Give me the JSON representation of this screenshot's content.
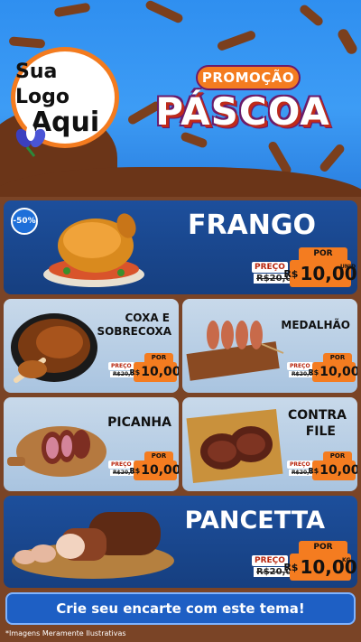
{
  "header": {
    "logo_line1": "Sua Logo",
    "logo_line2": "Aqui",
    "promo_top": "PROMOÇÃO",
    "promo_main": "PÁSCOA"
  },
  "colors": {
    "accent": "#f47c20",
    "card_dark": "#1d4f9c",
    "card_light": "#b7cde4",
    "chocolate": "#6b3518",
    "sky": "#3d9cf5"
  },
  "products": [
    {
      "name": "FRANGO",
      "badge": "-50%",
      "preco_label": "PREÇO",
      "old_price": "R$20,00",
      "por_label": "POR",
      "currency": "R$",
      "price": "10,00",
      "unit": "UNID"
    },
    {
      "name_line1": "COXA E",
      "name_line2": "SOBRECOXA",
      "preco_label": "PREÇO",
      "old_price": "R$20,00",
      "por_label": "POR",
      "currency": "R$",
      "price": "10,00"
    },
    {
      "name": "MEDALHÃO",
      "preco_label": "PREÇO",
      "old_price": "R$20,00",
      "por_label": "POR",
      "currency": "R$",
      "price": "10,00"
    },
    {
      "name": "PICANHA",
      "preco_label": "PREÇO",
      "old_price": "R$20,00",
      "por_label": "POR",
      "currency": "R$",
      "price": "10,00"
    },
    {
      "name_line1": "CONTRA",
      "name_line2": "FILE",
      "preco_label": "PREÇO",
      "old_price": "R$20,00",
      "por_label": "POR",
      "currency": "R$",
      "price": "10,00"
    },
    {
      "name": "PANCETTA",
      "preco_label": "PREÇO",
      "old_price": "R$20,00",
      "por_label": "POR",
      "currency": "R$",
      "price": "10,00",
      "unit": "KG"
    }
  ],
  "cta": "Crie seu encarte com este tema!",
  "footnote": "*Imagens Meramente Ilustrativas",
  "icons": [
    "flower-icon",
    "chicken-image",
    "drumstick-image",
    "skewer-image",
    "picanha-image",
    "steak-image",
    "pancetta-image"
  ]
}
